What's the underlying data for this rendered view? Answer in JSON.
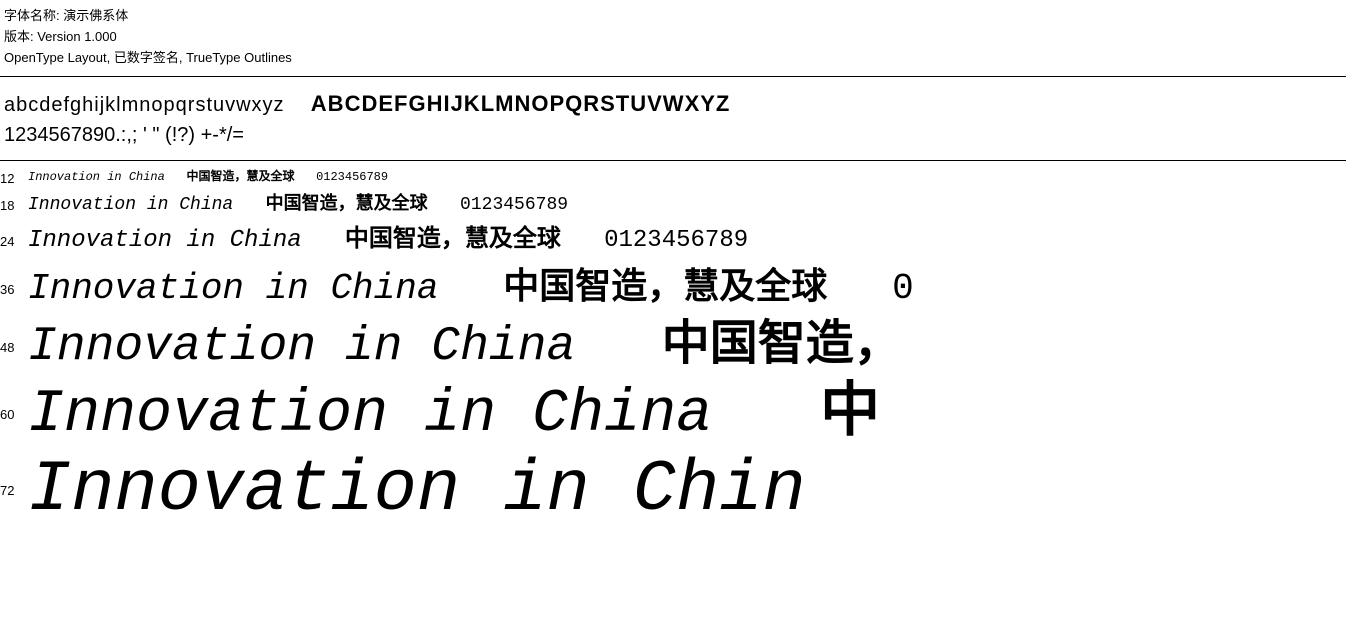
{
  "header": {
    "font_name_label": "字体名称: 演示佛系体",
    "version_label": "版本: Version 1.000",
    "opentype_label": "OpenType Layout, 已数字签名, TrueType Outlines"
  },
  "alphabet": {
    "lowercase": "abcdefghijklmnopqrstuvwxyz",
    "uppercase": "ABCDEFGHIJKLMNOPQRSTUVWXYZ",
    "numbers": "1234567890.:,;  '  \"  (!?)  +-*/="
  },
  "sizes": [
    {
      "id": "12",
      "label": "12",
      "latin": "Innovation in China",
      "chinese": "中国智造，慧及全球",
      "numbers": "0123456789"
    },
    {
      "id": "18",
      "label": "18",
      "latin": "Innovation in China",
      "chinese": "中国智造，慧及全球",
      "numbers": "0123456789"
    },
    {
      "id": "24",
      "label": "24",
      "latin": "Innovation in China",
      "chinese": "中国智造，慧及全球",
      "numbers": "0123456789"
    },
    {
      "id": "36",
      "label": "36",
      "latin": "Innovation in China",
      "chinese": "中国智造，慧及全球",
      "numbers": "0"
    },
    {
      "id": "48",
      "label": "48",
      "latin": "Innovation in China",
      "chinese": "中国智造，",
      "numbers": ""
    },
    {
      "id": "60",
      "label": "60",
      "latin": "Innovation in China",
      "chinese": "中",
      "numbers": ""
    },
    {
      "id": "72",
      "label": "72",
      "latin": "Innovation in Chin",
      "chinese": "",
      "numbers": ""
    }
  ]
}
